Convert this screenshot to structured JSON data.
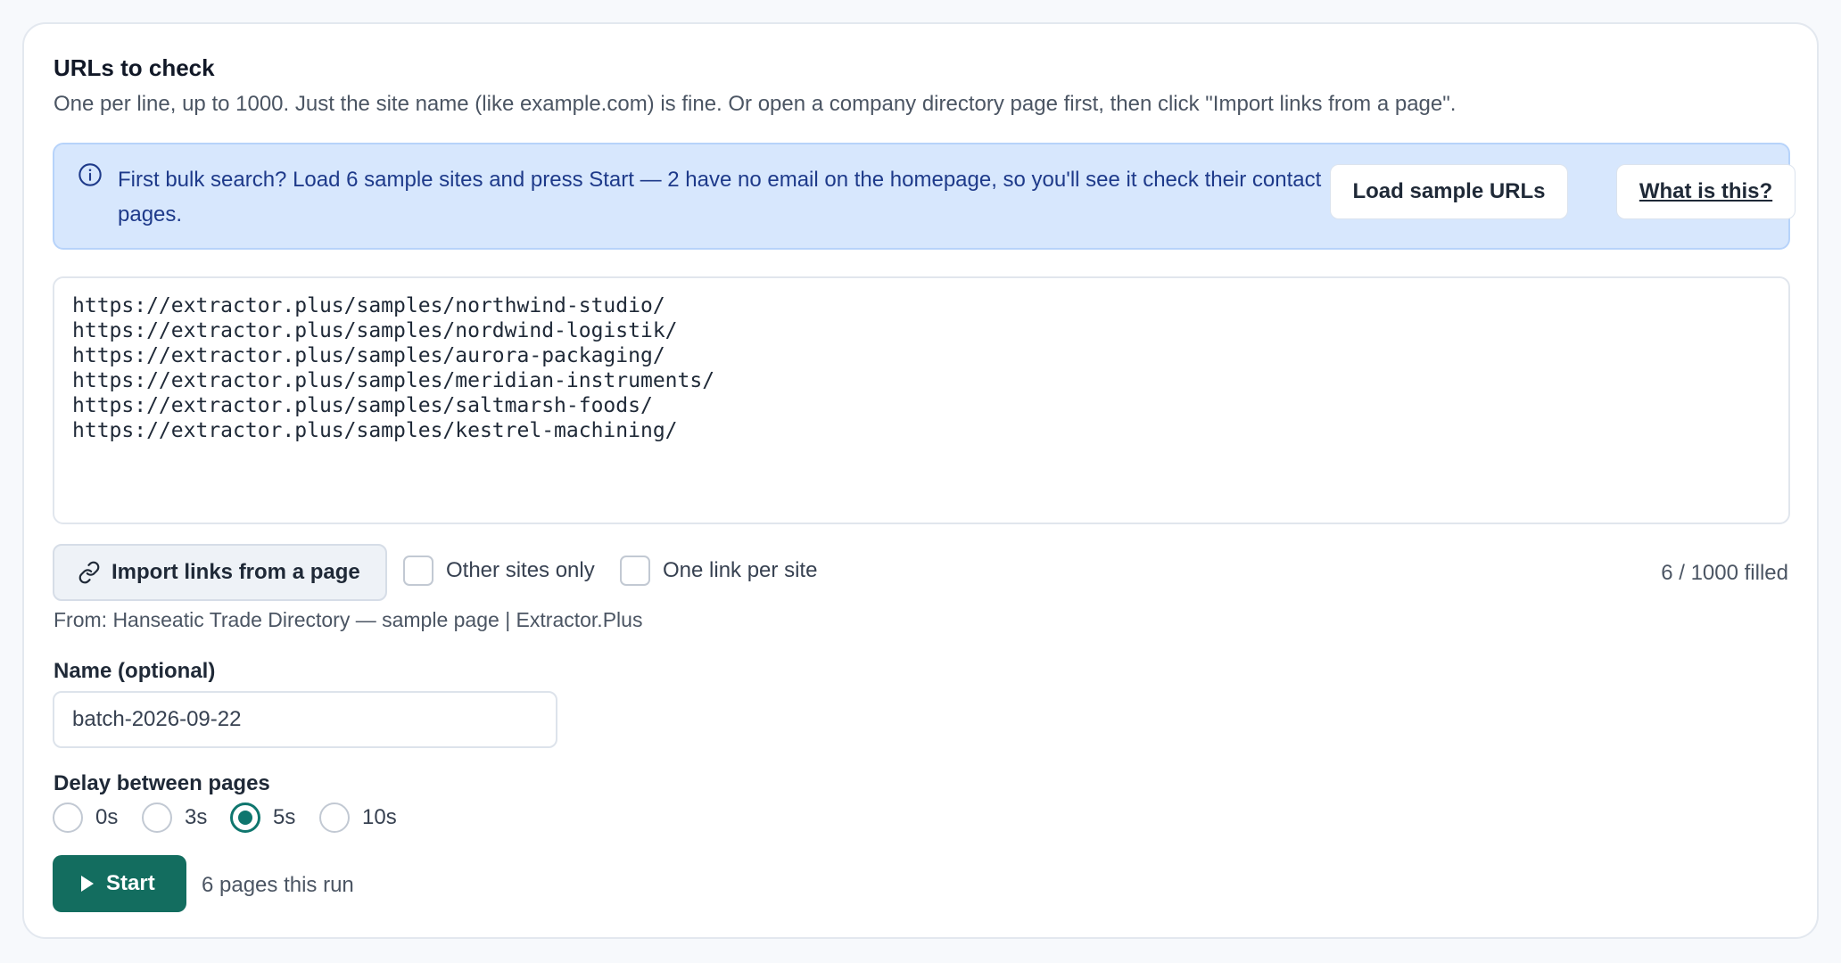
{
  "section": {
    "title": "URLs to check",
    "help": "One per line, up to 1000. Just the site name (like example.com) is fine. Or open a company directory page first, then click \"Import links from a page\"."
  },
  "banner": {
    "icon": "info-icon",
    "text": "First bulk search? Load 6 sample sites and press Start — 2 have no email on the homepage, so you'll see it check their contact pages.",
    "load_button": "Load sample URLs",
    "what_button": "What is this?"
  },
  "urls": {
    "value": "https://extractor.plus/samples/northwind-studio/\nhttps://extractor.plus/samples/nordwind-logistik/\nhttps://extractor.plus/samples/aurora-packaging/\nhttps://extractor.plus/samples/meridian-instruments/\nhttps://extractor.plus/samples/saltmarsh-foods/\nhttps://extractor.plus/samples/kestrel-machining/"
  },
  "import": {
    "icon": "link-icon",
    "button": "Import links from a page",
    "other_sites_only": "Other sites only",
    "one_link_per_site": "One link per site",
    "filled": "6 / 1000 filled",
    "from": "From: Hanseatic Trade Directory — sample page | Extractor.Plus"
  },
  "name": {
    "label": "Name (optional)",
    "value": "batch-2026-09-22"
  },
  "delay": {
    "label": "Delay between pages",
    "options": [
      "0s",
      "3s",
      "5s",
      "10s"
    ],
    "selected": "5s"
  },
  "run": {
    "start_button": "Start",
    "pages_text": "6 pages this run"
  },
  "colors": {
    "accent": "#136d5f",
    "banner_bg": "#d7e7fd",
    "banner_text": "#1e3a8a"
  }
}
